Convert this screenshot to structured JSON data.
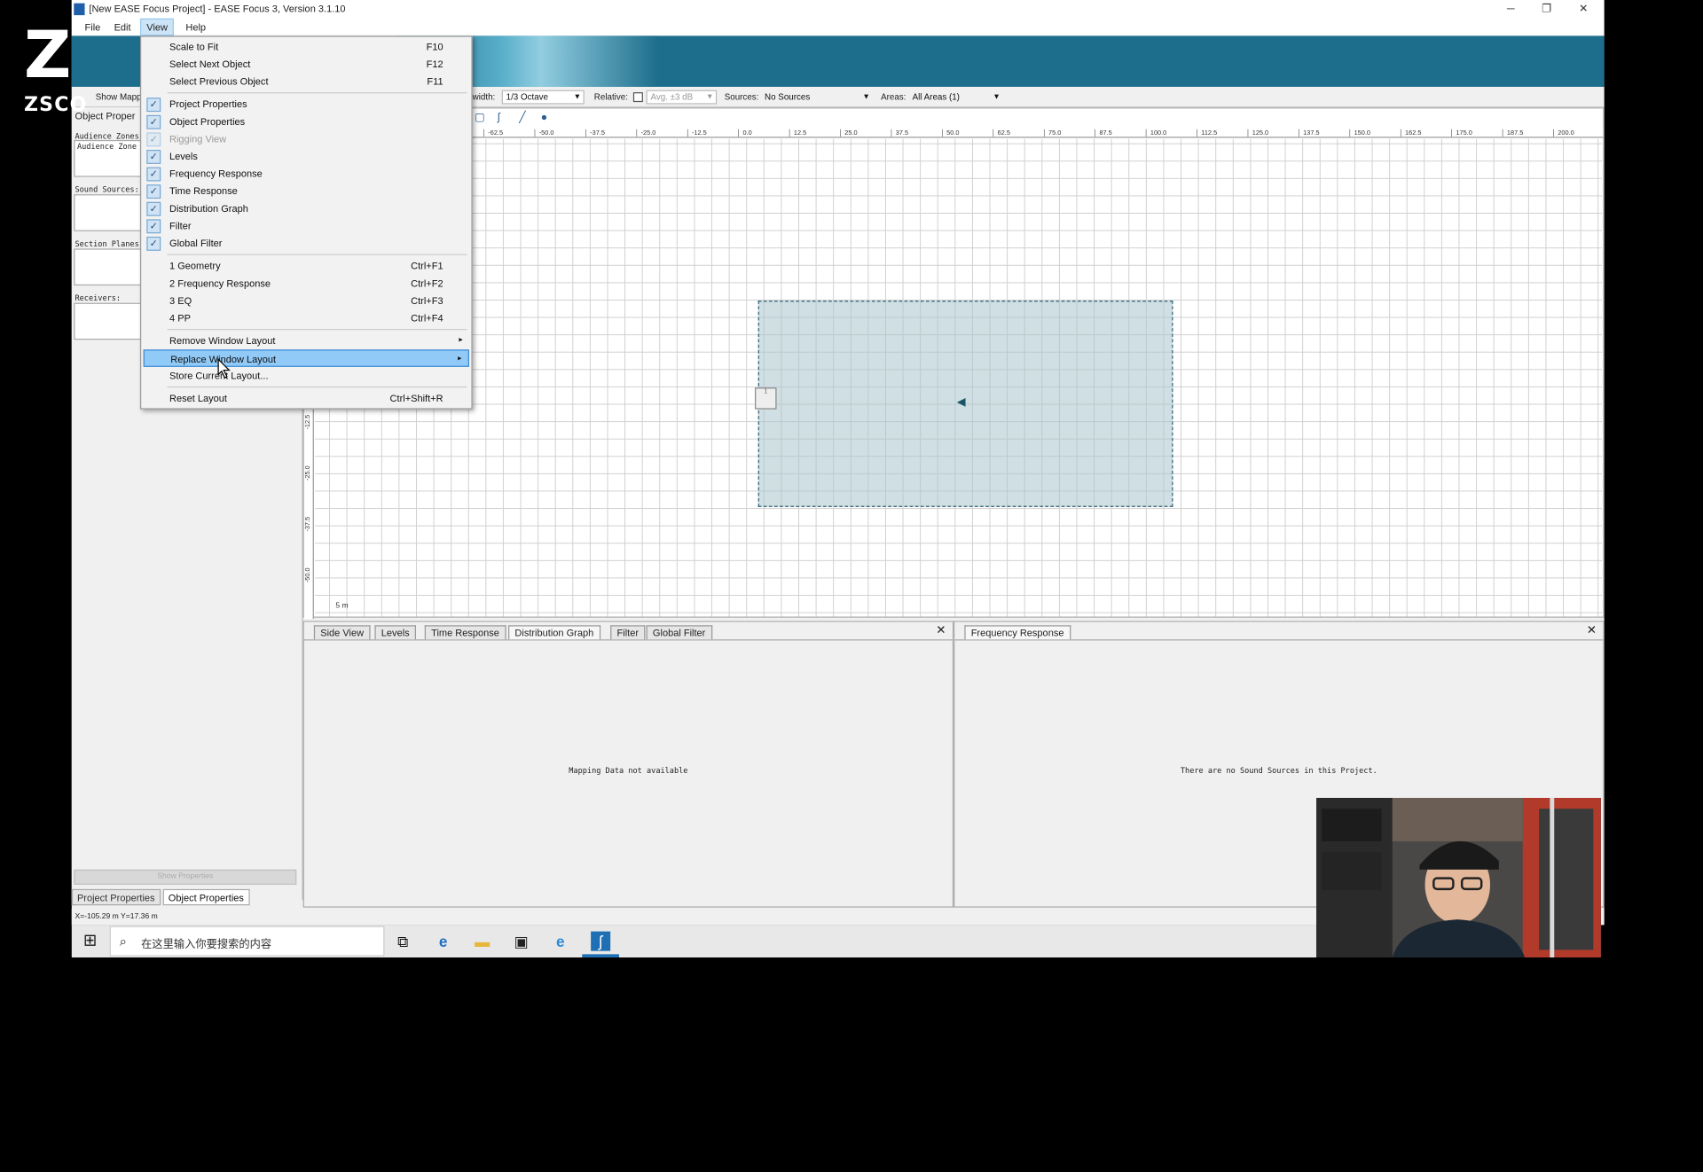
{
  "window": {
    "title": "[New EASE Focus Project] - EASE Focus 3, Version 3.1.10",
    "minimize": "─",
    "restore": "❐",
    "close": "✕"
  },
  "menubar": {
    "file": "File",
    "edit": "Edit",
    "view": "View",
    "help": "Help"
  },
  "view_menu": {
    "scale_to_fit": {
      "label": "Scale to Fit",
      "shortcut": "F10"
    },
    "select_next": {
      "label": "Select Next Object",
      "shortcut": "F12"
    },
    "select_prev": {
      "label": "Select Previous Object",
      "shortcut": "F11"
    },
    "project_properties": "Project Properties",
    "object_properties": "Object Properties",
    "rigging_view": "Rigging View",
    "levels": "Levels",
    "frequency_response": "Frequency Response",
    "time_response": "Time Response",
    "distribution_graph": "Distribution Graph",
    "filter": "Filter",
    "global_filter": "Global Filter",
    "layout1": {
      "label": "1 Geometry",
      "shortcut": "Ctrl+F1"
    },
    "layout2": {
      "label": "2 Frequency Response",
      "shortcut": "Ctrl+F2"
    },
    "layout3": {
      "label": "3 EQ",
      "shortcut": "Ctrl+F3"
    },
    "layout4": {
      "label": "4 PP",
      "shortcut": "Ctrl+F4"
    },
    "remove_layout": "Remove Window Layout",
    "replace_layout": "Replace Window Layout",
    "store_layout": "Store Current Layout...",
    "reset_layout": {
      "label": "Reset Layout",
      "shortcut": "Ctrl+Shift+R"
    },
    "check": "✓",
    "submenu_arrow": "▸"
  },
  "toolbar": {
    "show_mapping": "Show Mapp",
    "bandwidth_label": "width:",
    "bandwidth_value": "1/3 Octave",
    "relative_label": "Relative:",
    "avg_value": "Avg. ±3 dB",
    "sources_label": "Sources:",
    "sources_value": "No Sources",
    "areas_label": "Areas:",
    "areas_value": "All Areas (1)"
  },
  "left_panel": {
    "header": "Object Proper",
    "audience_zones": "Audience Zones",
    "audience_zone_item": "Audience Zone",
    "sound_sources": "Sound Sources:",
    "section_planes": "Section Planes",
    "receivers": "Receivers:",
    "show_properties": "Show Properties",
    "tab_project": "Project Properties",
    "tab_object": "Object Properties"
  },
  "ruler_x": [
    "-62.5",
    "-50.0",
    "-37.5",
    "-25.0",
    "-12.5",
    "0.0",
    "12.5",
    "25.0",
    "37.5",
    "50.0",
    "62.5",
    "75.0",
    "87.5",
    "100.0",
    "112.5",
    "125.0",
    "137.5",
    "150.0",
    "162.5",
    "175.0",
    "187.5",
    "200.0"
  ],
  "ruler_y": [
    "-12.5",
    "-25.0",
    "-37.5",
    "-50.0"
  ],
  "scale_label": "5 m",
  "bottom_left": {
    "tabs": [
      "Side View",
      "Levels",
      "Time Response",
      "Distribution Graph",
      "Filter",
      "Global Filter"
    ],
    "message": "Mapping Data not available"
  },
  "bottom_right": {
    "tabs": [
      "Frequency Response"
    ],
    "message": "There are no Sound Sources in this Project."
  },
  "status": "X=-105.29 m Y=17.36 m",
  "logo": {
    "mark": "Z",
    "text": "ZSCO"
  },
  "taskbar": {
    "search_placeholder": "在这里输入你要搜索的内容",
    "icons": [
      "start-icon",
      "task-view-icon",
      "edge-icon",
      "file-explorer-icon",
      "store-icon",
      "ie-icon",
      "ease-focus-icon"
    ]
  },
  "colors": {
    "banner": "#1d6e8c",
    "highlight": "#91c9f7",
    "zone": "#aac4cc",
    "accent": "#1f6fb5"
  }
}
